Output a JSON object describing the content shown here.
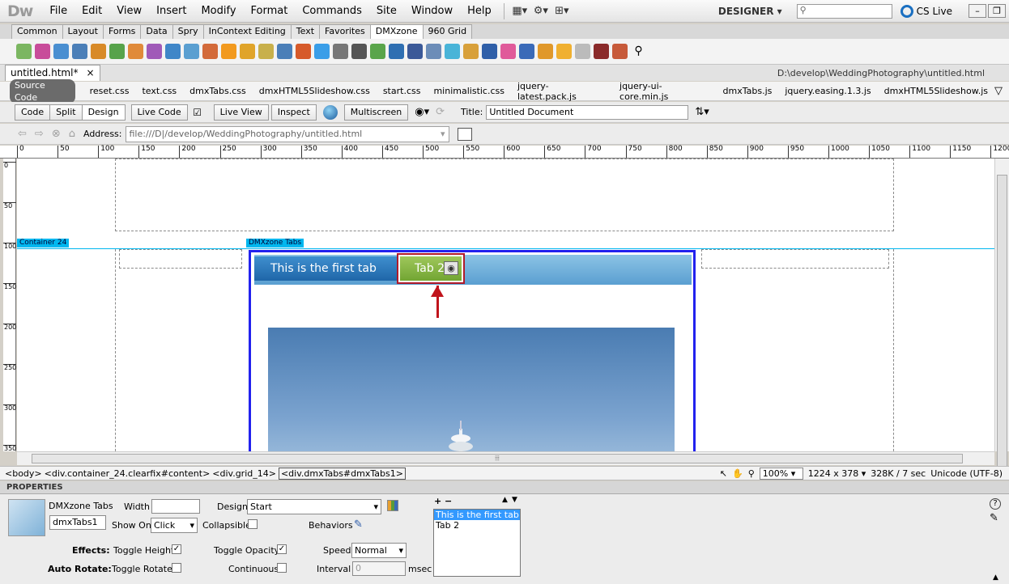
{
  "menubar": {
    "logo": "Dw",
    "items": [
      "File",
      "Edit",
      "View",
      "Insert",
      "Modify",
      "Format",
      "Commands",
      "Site",
      "Window",
      "Help"
    ],
    "workspace": "DESIGNER",
    "cs_live": "CS Live"
  },
  "insert_tabs": [
    "Common",
    "Layout",
    "Forms",
    "Data",
    "Spry",
    "InContext Editing",
    "Text",
    "Favorites",
    "DMXzone",
    "960 Grid"
  ],
  "insert_active": "DMXzone",
  "document": {
    "tab": "untitled.html*",
    "close": "×",
    "path": "D:\\develop\\WeddingPhotography\\untitled.html"
  },
  "related_files": {
    "source": "Source Code",
    "files": [
      "reset.css",
      "text.css",
      "dmxTabs.css",
      "dmxHTML5Slideshow.css",
      "start.css",
      "minimalistic.css",
      "jquery-latest.pack.js",
      "jquery-ui-core.min.js",
      "dmxTabs.js",
      "jquery.easing.1.3.js",
      "dmxHTML5Slideshow.js"
    ]
  },
  "doc_toolbar": {
    "views": [
      "Code",
      "Split",
      "Design"
    ],
    "live_code": "Live Code",
    "live_view": "Live View",
    "inspect": "Inspect",
    "multiscreen": "Multiscreen",
    "title_label": "Title:",
    "title_value": "Untitled Document"
  },
  "address": {
    "label": "Address:",
    "value": "file:///D|/develop/WeddingPhotography/untitled.html"
  },
  "ruler_ticks": [
    "0",
    "50",
    "100",
    "150",
    "200",
    "250",
    "300",
    "350",
    "400",
    "450",
    "500",
    "550",
    "600",
    "650",
    "700",
    "750",
    "800",
    "850",
    "900",
    "950",
    "1000",
    "1050",
    "1100",
    "1150",
    "1200"
  ],
  "vruler_ticks": [
    "0",
    "50",
    "100",
    "150",
    "200",
    "250",
    "300",
    "350"
  ],
  "canvas": {
    "container_label": "Container 24",
    "tabs_label": "DMXzone Tabs",
    "tab1": "This is the first tab",
    "tab2": "Tab 2"
  },
  "status": {
    "tags": [
      "<body>",
      "<div.container_24.clearfix#content>",
      "<div.grid_14>",
      "<div.dmxTabs#dmxTabs1>"
    ],
    "zoom": "100%",
    "size": "1224 x 378",
    "weight": "328K / 7 sec",
    "encoding": "Unicode (UTF-8)"
  },
  "properties": {
    "header": "PROPERTIES",
    "component": "DMXzone Tabs",
    "id": "dmxTabs1",
    "width_label": "Width",
    "width_value": "",
    "design_label": "Design",
    "design_value": "Start",
    "show_on_label": "Show On",
    "show_on_value": "Click",
    "collapsible_label": "Collapsible",
    "behaviors_label": "Behaviors",
    "effects_label": "Effects:",
    "toggle_height": "Toggle Height",
    "toggle_opacity": "Toggle Opacity",
    "speed_label": "Speed",
    "speed_value": "Normal",
    "auto_rotate_label": "Auto Rotate:",
    "toggle_rotate": "Toggle Rotate",
    "continuous": "Continuous",
    "interval_label": "Interval",
    "interval_value": "0",
    "interval_unit": "msec",
    "tab_list": [
      "This is the first tab",
      "Tab 2"
    ]
  },
  "colors": {
    "tab_blue": "#1f66a8",
    "tab_green": "#72a533",
    "highlight_red": "#c0141c",
    "selection_blue": "#2222ee"
  }
}
